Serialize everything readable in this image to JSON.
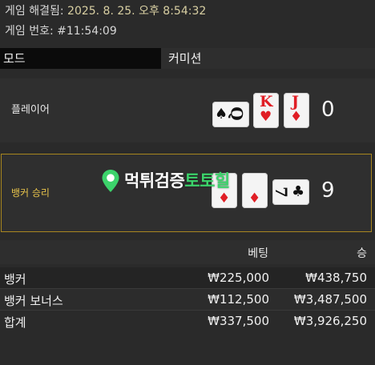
{
  "header": {
    "resolved_label": "게임 해결됨: ",
    "resolved_time": "2025. 8. 25. 오후 8:54:32",
    "game_number": "게임 번호: #11:54:09"
  },
  "tabs": {
    "mode": "모드",
    "commission": "커미션"
  },
  "player": {
    "label": "플레이어",
    "score": "0",
    "cards": [
      {
        "rank": "Q",
        "suit": "♠",
        "suit_name": "spade",
        "color": "black",
        "orientation": "sideways"
      },
      {
        "rank": "K",
        "suit": "♥",
        "suit_name": "heart",
        "color": "red",
        "orientation": "upright"
      },
      {
        "rank": "J",
        "suit": "♦",
        "suit_name": "diamond",
        "color": "red",
        "orientation": "upright"
      }
    ]
  },
  "banker": {
    "label": "뱅커 승리",
    "score": "9",
    "cards": [
      {
        "rank": "",
        "suit": "♦",
        "suit_name": "diamond",
        "color": "red",
        "orientation": "upright"
      },
      {
        "rank": "",
        "suit": "♦",
        "suit_name": "diamond",
        "color": "red",
        "orientation": "upright"
      },
      {
        "rank": "7",
        "suit": "♣",
        "suit_name": "club",
        "color": "black",
        "orientation": "sideways"
      }
    ],
    "highlight_color": "#a8861f"
  },
  "watermark": {
    "text_white": "먹튀검증",
    "text_green": "토토힐"
  },
  "table": {
    "headers": {
      "bet": "베팅",
      "win": "승"
    },
    "rows": [
      {
        "label": "뱅커",
        "bet": "₩225,000",
        "win": "₩438,750"
      },
      {
        "label": "뱅커 보너스",
        "bet": "₩112,500",
        "win": "₩3,487,500"
      },
      {
        "label": "합계",
        "bet": "₩337,500",
        "win": "₩3,926,250"
      }
    ]
  },
  "colors": {
    "background": "#2a2a2a",
    "accent_gold": "#e6c24a",
    "card_red": "#e01e25",
    "watermark_green": "#3cd36b"
  }
}
